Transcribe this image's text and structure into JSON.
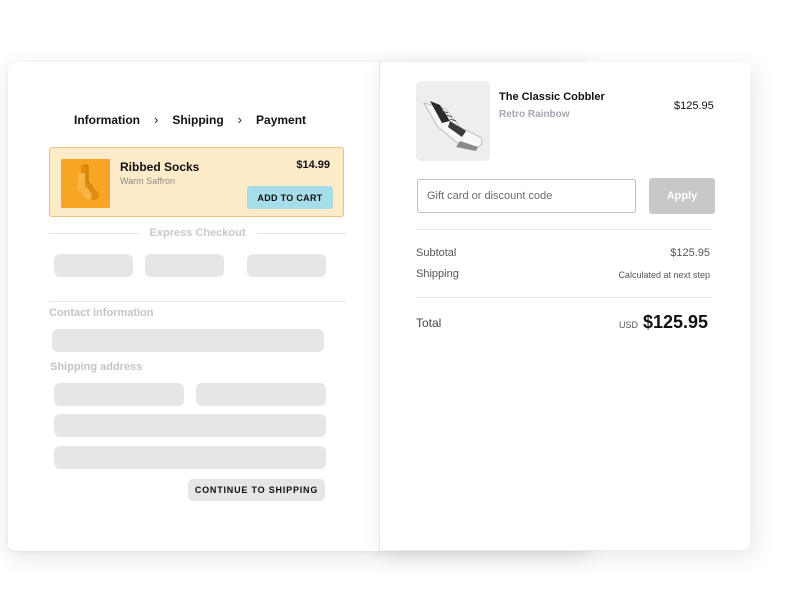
{
  "breadcrumb": {
    "steps": [
      "Information",
      "Shipping",
      "Payment"
    ],
    "separator": "›"
  },
  "upsell": {
    "title": "Ribbed Socks",
    "variant": "Warm Saffron",
    "price": "$14.99",
    "button_label": "ADD TO CART",
    "image_icon": "socks-image",
    "accent_color": "#fdebc9",
    "button_color": "#a6dde8"
  },
  "express": {
    "label": "Express Checkout"
  },
  "contact": {
    "label": "Contact information"
  },
  "shipping_address": {
    "label": "Shipping address"
  },
  "continue_button": {
    "label": "CONTINUE TO SHIPPING"
  },
  "summary": {
    "product": {
      "title": "The Classic Cobbler",
      "variant": "Retro Rainbow",
      "price": "$125.95",
      "image_icon": "sneaker-image"
    },
    "discount": {
      "placeholder": "Gift card or discount code",
      "apply_label": "Apply"
    },
    "subtotal_label": "Subtotal",
    "subtotal_value": "$125.95",
    "shipping_label": "Shipping",
    "shipping_value": "Calculated at next step",
    "total_label": "Total",
    "total_currency": "USD",
    "total_value": "$125.95"
  }
}
